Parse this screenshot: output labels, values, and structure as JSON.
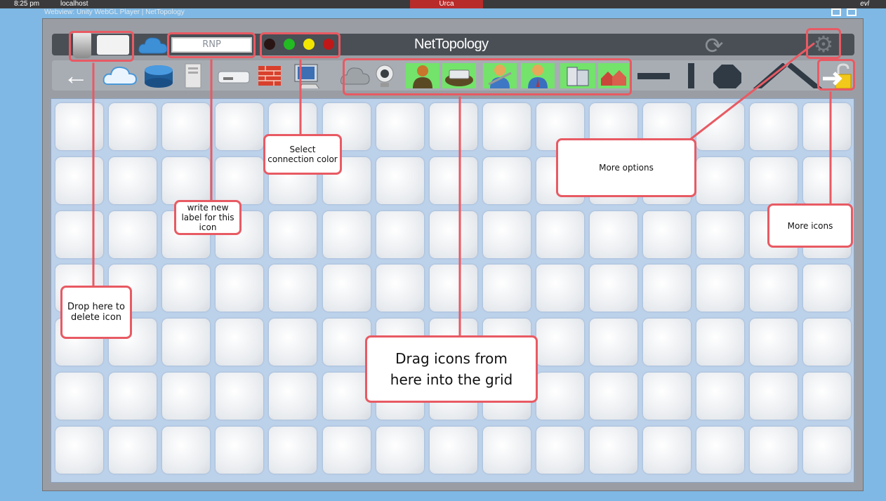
{
  "system_bar": {
    "time": "8:25 pm",
    "host": "localhost",
    "center_label": "Urca",
    "brand": "evl"
  },
  "window": {
    "title": "Webview: Unity WebGL Player | NetTopology"
  },
  "header": {
    "label_input_value": "RNP",
    "app_title": "NetTopology",
    "connection_colors": [
      "#2a1515",
      "#22bb22",
      "#f2e600",
      "#c01818"
    ]
  },
  "toolbar": {
    "icons": [
      "back-arrow-icon",
      "cloud-icon",
      "database-icon",
      "server-tower-icon",
      "switch-icon",
      "firewall-icon",
      "desktop-computer-icon",
      "gray-cloud-icon",
      "webcam-icon",
      "user-person-icon",
      "router-device-icon",
      "technician-icon",
      "businessman-icon",
      "office-buildings-icon",
      "houses-icon",
      "horizontal-line-icon",
      "vertical-line-icon",
      "octagon-shape-icon",
      "diagonal-line-icon",
      "diagonal-line-reverse-icon",
      "unlocked-more-icons-icon"
    ]
  },
  "grid": {
    "rows": 7,
    "columns": 15
  },
  "annotations": {
    "delete": "Drop here to delete icon",
    "label": "write new label for this icon",
    "color": "Select connection color",
    "options": "More options",
    "more_icons": "More icons",
    "drag": "Drag icons from here into the grid"
  }
}
